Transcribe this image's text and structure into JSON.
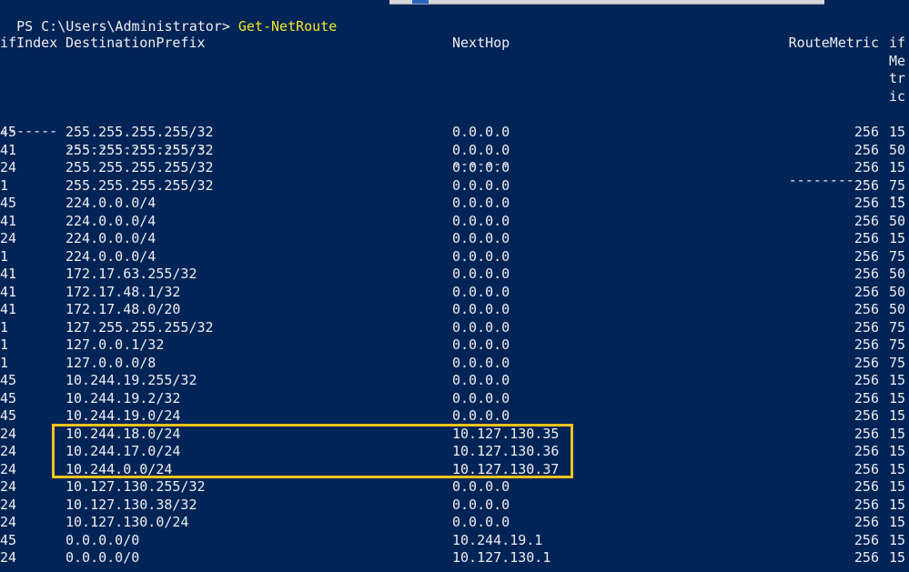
{
  "prompt": {
    "text": "PS C:\\Users\\Administrator> ",
    "command": "Get-NetRoute"
  },
  "headers": {
    "ifindex": "ifIndex",
    "destination": "DestinationPrefix",
    "nexthop": "NextHop",
    "routemetric": "RouteMetric",
    "ifmetric_lines": [
      "if",
      "Me",
      "tr",
      "ic"
    ]
  },
  "separators": {
    "ifindex": "-------",
    "destination": "-----------------",
    "nexthop": "-------",
    "routemetric": "-----------",
    "ifmetric": "--"
  },
  "rows": [
    {
      "ifIndex": "45",
      "dest": "255.255.255.255/32",
      "hop": "0.0.0.0",
      "metric": "256",
      "ifMetric": "15"
    },
    {
      "ifIndex": "41",
      "dest": "255.255.255.255/32",
      "hop": "0.0.0.0",
      "metric": "256",
      "ifMetric": "50"
    },
    {
      "ifIndex": "24",
      "dest": "255.255.255.255/32",
      "hop": "0.0.0.0",
      "metric": "256",
      "ifMetric": "15"
    },
    {
      "ifIndex": "1",
      "dest": "255.255.255.255/32",
      "hop": "0.0.0.0",
      "metric": "256",
      "ifMetric": "75"
    },
    {
      "ifIndex": "45",
      "dest": "224.0.0.0/4",
      "hop": "0.0.0.0",
      "metric": "256",
      "ifMetric": "15"
    },
    {
      "ifIndex": "41",
      "dest": "224.0.0.0/4",
      "hop": "0.0.0.0",
      "metric": "256",
      "ifMetric": "50"
    },
    {
      "ifIndex": "24",
      "dest": "224.0.0.0/4",
      "hop": "0.0.0.0",
      "metric": "256",
      "ifMetric": "15"
    },
    {
      "ifIndex": "1",
      "dest": "224.0.0.0/4",
      "hop": "0.0.0.0",
      "metric": "256",
      "ifMetric": "75"
    },
    {
      "ifIndex": "41",
      "dest": "172.17.63.255/32",
      "hop": "0.0.0.0",
      "metric": "256",
      "ifMetric": "50"
    },
    {
      "ifIndex": "41",
      "dest": "172.17.48.1/32",
      "hop": "0.0.0.0",
      "metric": "256",
      "ifMetric": "50"
    },
    {
      "ifIndex": "41",
      "dest": "172.17.48.0/20",
      "hop": "0.0.0.0",
      "metric": "256",
      "ifMetric": "50"
    },
    {
      "ifIndex": "1",
      "dest": "127.255.255.255/32",
      "hop": "0.0.0.0",
      "metric": "256",
      "ifMetric": "75"
    },
    {
      "ifIndex": "1",
      "dest": "127.0.0.1/32",
      "hop": "0.0.0.0",
      "metric": "256",
      "ifMetric": "75"
    },
    {
      "ifIndex": "1",
      "dest": "127.0.0.0/8",
      "hop": "0.0.0.0",
      "metric": "256",
      "ifMetric": "75"
    },
    {
      "ifIndex": "45",
      "dest": "10.244.19.255/32",
      "hop": "0.0.0.0",
      "metric": "256",
      "ifMetric": "15"
    },
    {
      "ifIndex": "45",
      "dest": "10.244.19.2/32",
      "hop": "0.0.0.0",
      "metric": "256",
      "ifMetric": "15"
    },
    {
      "ifIndex": "45",
      "dest": "10.244.19.0/24",
      "hop": "0.0.0.0",
      "metric": "256",
      "ifMetric": "15"
    },
    {
      "ifIndex": "24",
      "dest": "10.244.18.0/24",
      "hop": "10.127.130.35",
      "metric": "256",
      "ifMetric": "15"
    },
    {
      "ifIndex": "24",
      "dest": "10.244.17.0/24",
      "hop": "10.127.130.36",
      "metric": "256",
      "ifMetric": "15"
    },
    {
      "ifIndex": "24",
      "dest": "10.244.0.0/24",
      "hop": "10.127.130.37",
      "metric": "256",
      "ifMetric": "15"
    },
    {
      "ifIndex": "24",
      "dest": "10.127.130.255/32",
      "hop": "0.0.0.0",
      "metric": "256",
      "ifMetric": "15"
    },
    {
      "ifIndex": "24",
      "dest": "10.127.130.38/32",
      "hop": "0.0.0.0",
      "metric": "256",
      "ifMetric": "15"
    },
    {
      "ifIndex": "24",
      "dest": "10.127.130.0/24",
      "hop": "0.0.0.0",
      "metric": "256",
      "ifMetric": "15"
    },
    {
      "ifIndex": "45",
      "dest": "0.0.0.0/0",
      "hop": "10.244.19.1",
      "metric": "256",
      "ifMetric": "15"
    },
    {
      "ifIndex": "24",
      "dest": "0.0.0.0/0",
      "hop": "10.127.130.1",
      "metric": "256",
      "ifMetric": "15"
    }
  ],
  "highlight": {
    "color": "#f7c31c"
  },
  "colors": {
    "background": "#012456",
    "text": "#eeedf0",
    "command": "#f2e72b"
  }
}
